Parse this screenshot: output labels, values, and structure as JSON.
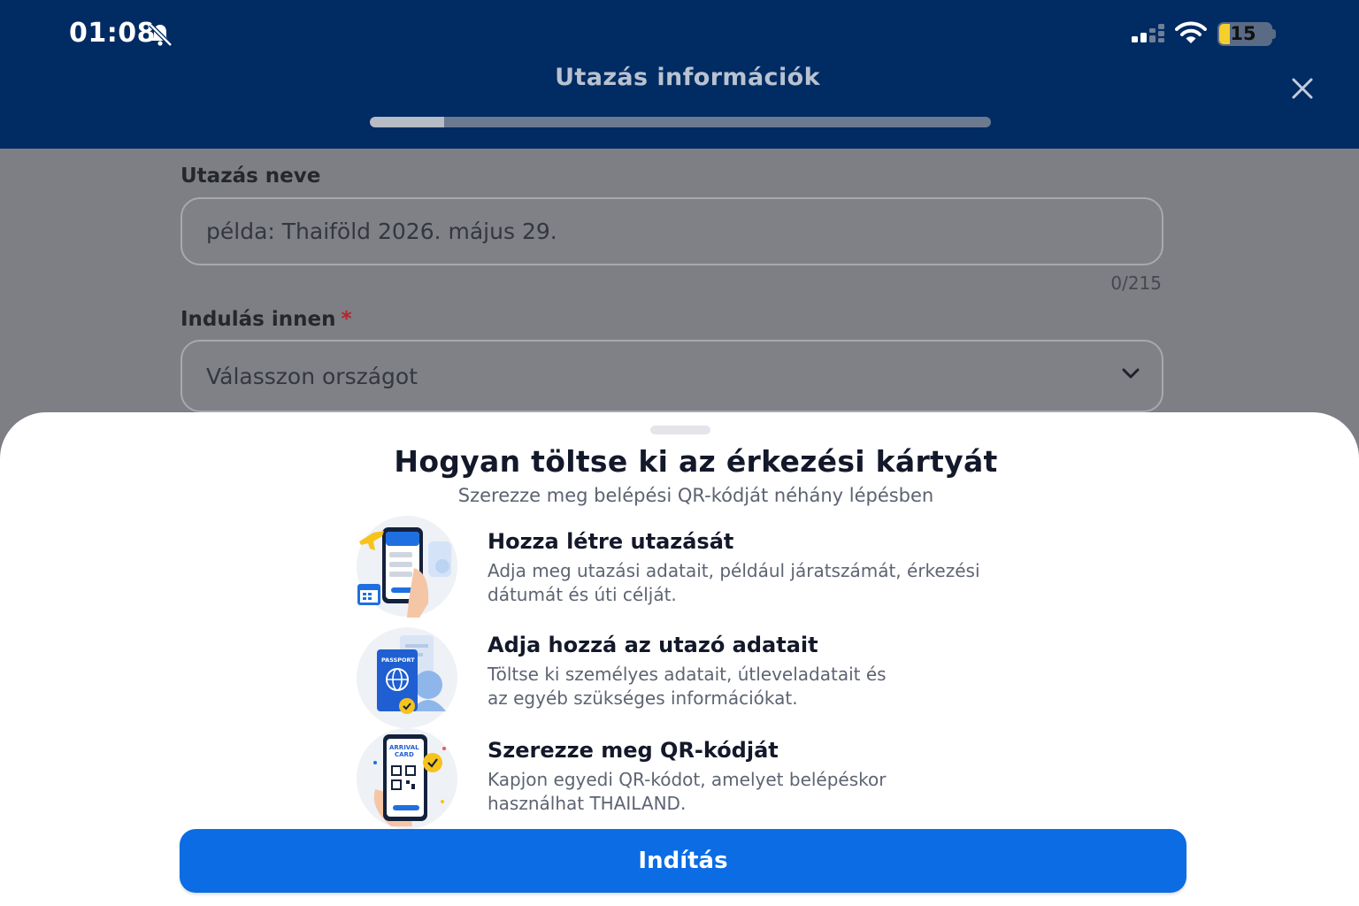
{
  "status_bar": {
    "time": "01:08",
    "battery_level": "15",
    "icons": [
      "bell-off-icon",
      "cellular-signal-icon",
      "wifi-icon",
      "battery-icon"
    ]
  },
  "header": {
    "title": "Utazás információk",
    "progress_fraction": 0.12,
    "close_icon": "close-icon"
  },
  "form": {
    "trip_name": {
      "label": "Utazás neve",
      "placeholder": "példa: Thaiföld 2026. május 29.",
      "counter": "0/215"
    },
    "departure": {
      "label": "Indulás innen",
      "required_mark": "*",
      "placeholder": "Válasszon országot"
    }
  },
  "sheet": {
    "title": "Hogyan töltse ki az érkezési kártyát",
    "subtitle": "Szerezze meg belépési QR-kódját néhány lépésben",
    "steps": [
      {
        "icon": "phone-trip-icon",
        "title": "Hozza létre utazását",
        "desc_line1": "Adja meg utazási adatait, például járatszámát, érkezési",
        "desc_line2": "dátumát és úti célját."
      },
      {
        "icon": "passport-icon",
        "title": "Adja hozzá az utazó adatait",
        "desc_line1": "Töltse ki személyes adatait, útleveladatait és",
        "desc_line2": "az egyéb szükséges információkat.",
        "illustration_text": "PASSPORT"
      },
      {
        "icon": "qr-code-phone-icon",
        "title": "Szerezze meg QR-kódját",
        "desc_line1": "Kapjon egyedi QR-kódot, amelyet belépéskor",
        "desc_line2": "használhat THAILAND.",
        "illustration_text_1": "ARRIVAL",
        "illustration_text_2": "CARD"
      }
    ],
    "button_label": "Indítás"
  },
  "colors": {
    "header_bg": "#002b63",
    "primary_button": "#0b6ce4",
    "overlay_bg": "#7d7f84"
  }
}
